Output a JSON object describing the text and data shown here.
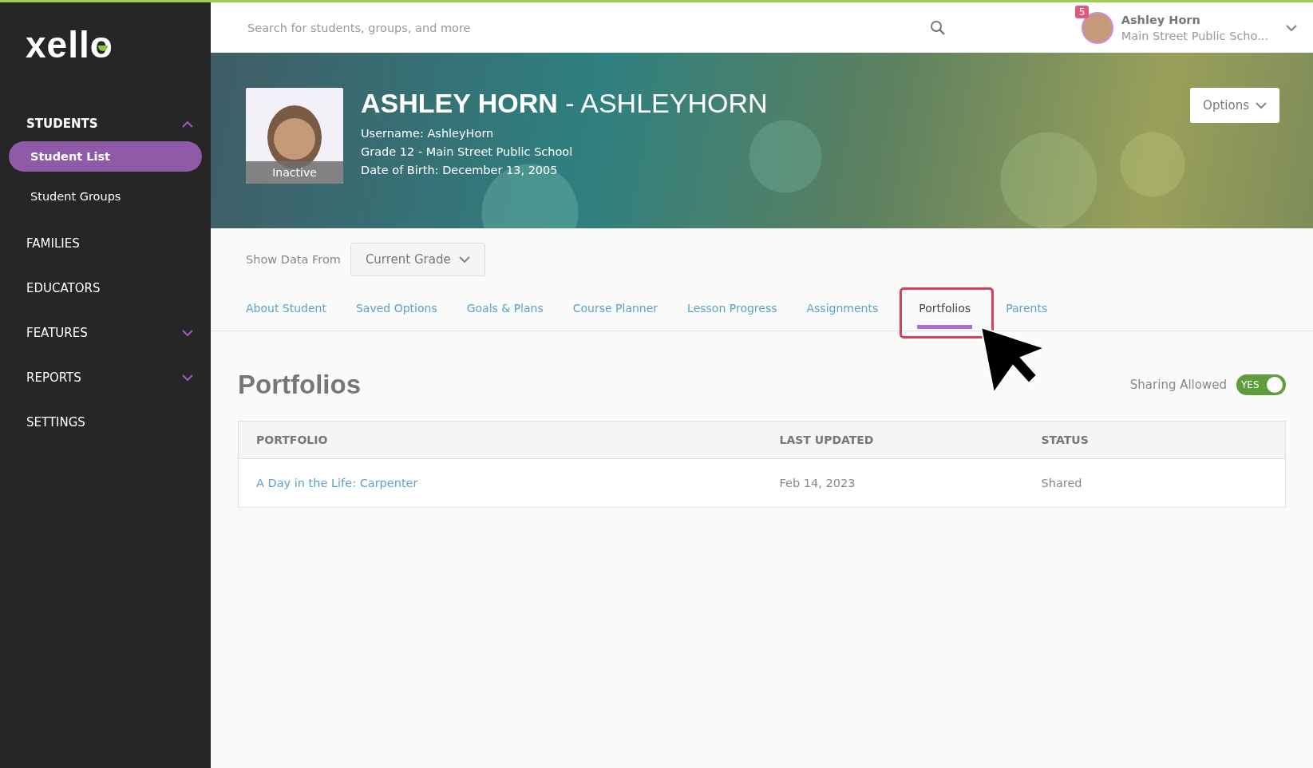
{
  "sidebar": {
    "logo": "xello",
    "items": [
      {
        "kind": "group",
        "label": "STUDENTS",
        "expanded": true,
        "children": [
          {
            "label": "Student List",
            "selected": true
          },
          {
            "label": "Student Groups",
            "selected": false
          }
        ]
      },
      {
        "kind": "link",
        "label": "FAMILIES"
      },
      {
        "kind": "link",
        "label": "EDUCATORS"
      },
      {
        "kind": "group",
        "label": "FEATURES",
        "expanded": false
      },
      {
        "kind": "group",
        "label": "REPORTS",
        "expanded": false
      },
      {
        "kind": "link",
        "label": "SETTINGS"
      }
    ]
  },
  "top_bar": {
    "search": {
      "placeholder": "Search for students, groups, and more"
    },
    "notification_count": "5",
    "user": {
      "name": "Ashley Horn",
      "school": "Main Street Public Scho..."
    }
  },
  "profile": {
    "name": "ASHLEY HORN",
    "name_separator": "-",
    "username_title": "ASHLEYHORN",
    "status": "Inactive",
    "details": [
      "Username: AshleyHorn",
      "Grade 12 - Main Street Public School",
      "Date of Birth: December 13, 2005"
    ],
    "options_button": "Options"
  },
  "filter": {
    "label": "Show Data From",
    "value": "Current Grade"
  },
  "tabs": [
    {
      "label": "About Student",
      "selected": false,
      "highlighted": false
    },
    {
      "label": "Saved Options",
      "selected": false,
      "highlighted": false
    },
    {
      "label": "Goals & Plans",
      "selected": false,
      "highlighted": false
    },
    {
      "label": "Course Planner",
      "selected": false,
      "highlighted": false
    },
    {
      "label": "Lesson Progress",
      "selected": false,
      "highlighted": false
    },
    {
      "label": "Assignments",
      "selected": false,
      "highlighted": false
    },
    {
      "label": "Portfolios",
      "selected": true,
      "highlighted": true
    },
    {
      "label": "Parents",
      "selected": false,
      "highlighted": false
    }
  ],
  "section": {
    "title": "Portfolios",
    "sharing": {
      "label": "Sharing Allowed",
      "on": true,
      "toggle_text": "YES"
    }
  },
  "table": {
    "columns": [
      "PORTFOLIO",
      "LAST UPDATED",
      "STATUS"
    ],
    "rows": [
      [
        "A Day in the Life: Carpenter",
        "Feb 14, 2023",
        "Shared"
      ]
    ]
  }
}
